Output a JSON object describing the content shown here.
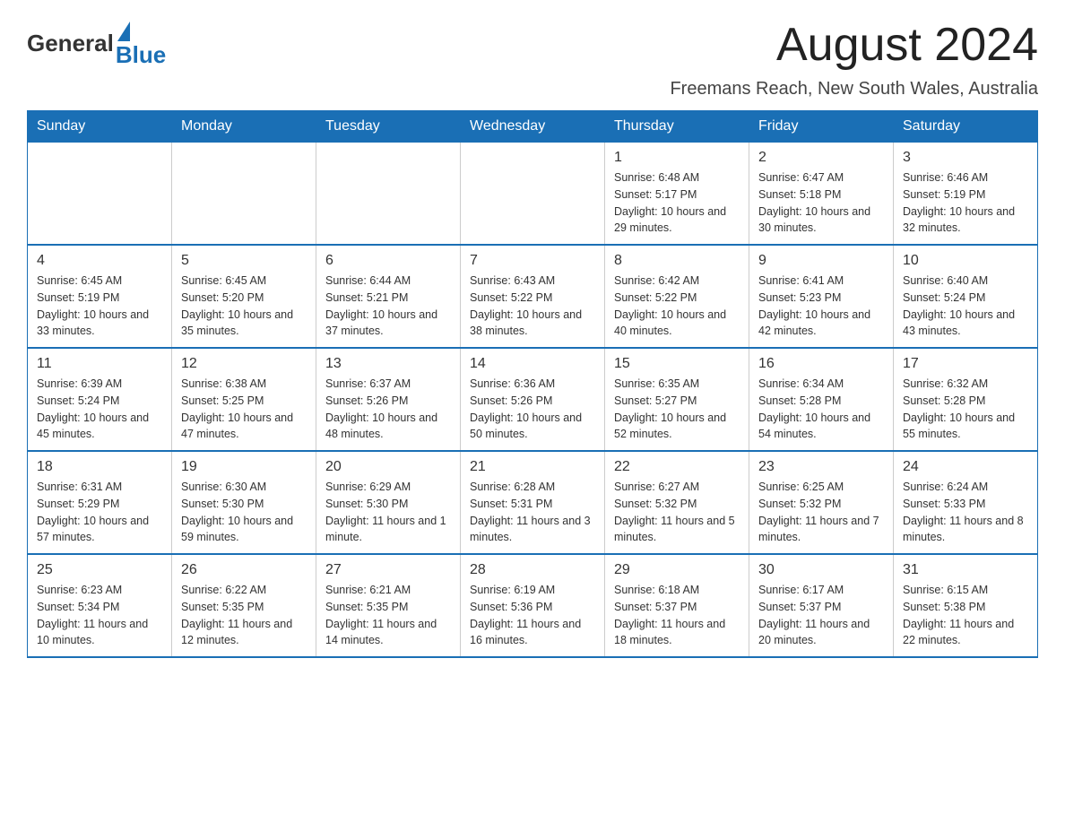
{
  "logo": {
    "general": "General",
    "blue": "Blue"
  },
  "title": "August 2024",
  "subtitle": "Freemans Reach, New South Wales, Australia",
  "days_of_week": [
    "Sunday",
    "Monday",
    "Tuesday",
    "Wednesday",
    "Thursday",
    "Friday",
    "Saturday"
  ],
  "weeks": [
    [
      {
        "day": "",
        "info": ""
      },
      {
        "day": "",
        "info": ""
      },
      {
        "day": "",
        "info": ""
      },
      {
        "day": "",
        "info": ""
      },
      {
        "day": "1",
        "info": "Sunrise: 6:48 AM\nSunset: 5:17 PM\nDaylight: 10 hours and 29 minutes."
      },
      {
        "day": "2",
        "info": "Sunrise: 6:47 AM\nSunset: 5:18 PM\nDaylight: 10 hours and 30 minutes."
      },
      {
        "day": "3",
        "info": "Sunrise: 6:46 AM\nSunset: 5:19 PM\nDaylight: 10 hours and 32 minutes."
      }
    ],
    [
      {
        "day": "4",
        "info": "Sunrise: 6:45 AM\nSunset: 5:19 PM\nDaylight: 10 hours and 33 minutes."
      },
      {
        "day": "5",
        "info": "Sunrise: 6:45 AM\nSunset: 5:20 PM\nDaylight: 10 hours and 35 minutes."
      },
      {
        "day": "6",
        "info": "Sunrise: 6:44 AM\nSunset: 5:21 PM\nDaylight: 10 hours and 37 minutes."
      },
      {
        "day": "7",
        "info": "Sunrise: 6:43 AM\nSunset: 5:22 PM\nDaylight: 10 hours and 38 minutes."
      },
      {
        "day": "8",
        "info": "Sunrise: 6:42 AM\nSunset: 5:22 PM\nDaylight: 10 hours and 40 minutes."
      },
      {
        "day": "9",
        "info": "Sunrise: 6:41 AM\nSunset: 5:23 PM\nDaylight: 10 hours and 42 minutes."
      },
      {
        "day": "10",
        "info": "Sunrise: 6:40 AM\nSunset: 5:24 PM\nDaylight: 10 hours and 43 minutes."
      }
    ],
    [
      {
        "day": "11",
        "info": "Sunrise: 6:39 AM\nSunset: 5:24 PM\nDaylight: 10 hours and 45 minutes."
      },
      {
        "day": "12",
        "info": "Sunrise: 6:38 AM\nSunset: 5:25 PM\nDaylight: 10 hours and 47 minutes."
      },
      {
        "day": "13",
        "info": "Sunrise: 6:37 AM\nSunset: 5:26 PM\nDaylight: 10 hours and 48 minutes."
      },
      {
        "day": "14",
        "info": "Sunrise: 6:36 AM\nSunset: 5:26 PM\nDaylight: 10 hours and 50 minutes."
      },
      {
        "day": "15",
        "info": "Sunrise: 6:35 AM\nSunset: 5:27 PM\nDaylight: 10 hours and 52 minutes."
      },
      {
        "day": "16",
        "info": "Sunrise: 6:34 AM\nSunset: 5:28 PM\nDaylight: 10 hours and 54 minutes."
      },
      {
        "day": "17",
        "info": "Sunrise: 6:32 AM\nSunset: 5:28 PM\nDaylight: 10 hours and 55 minutes."
      }
    ],
    [
      {
        "day": "18",
        "info": "Sunrise: 6:31 AM\nSunset: 5:29 PM\nDaylight: 10 hours and 57 minutes."
      },
      {
        "day": "19",
        "info": "Sunrise: 6:30 AM\nSunset: 5:30 PM\nDaylight: 10 hours and 59 minutes."
      },
      {
        "day": "20",
        "info": "Sunrise: 6:29 AM\nSunset: 5:30 PM\nDaylight: 11 hours and 1 minute."
      },
      {
        "day": "21",
        "info": "Sunrise: 6:28 AM\nSunset: 5:31 PM\nDaylight: 11 hours and 3 minutes."
      },
      {
        "day": "22",
        "info": "Sunrise: 6:27 AM\nSunset: 5:32 PM\nDaylight: 11 hours and 5 minutes."
      },
      {
        "day": "23",
        "info": "Sunrise: 6:25 AM\nSunset: 5:32 PM\nDaylight: 11 hours and 7 minutes."
      },
      {
        "day": "24",
        "info": "Sunrise: 6:24 AM\nSunset: 5:33 PM\nDaylight: 11 hours and 8 minutes."
      }
    ],
    [
      {
        "day": "25",
        "info": "Sunrise: 6:23 AM\nSunset: 5:34 PM\nDaylight: 11 hours and 10 minutes."
      },
      {
        "day": "26",
        "info": "Sunrise: 6:22 AM\nSunset: 5:35 PM\nDaylight: 11 hours and 12 minutes."
      },
      {
        "day": "27",
        "info": "Sunrise: 6:21 AM\nSunset: 5:35 PM\nDaylight: 11 hours and 14 minutes."
      },
      {
        "day": "28",
        "info": "Sunrise: 6:19 AM\nSunset: 5:36 PM\nDaylight: 11 hours and 16 minutes."
      },
      {
        "day": "29",
        "info": "Sunrise: 6:18 AM\nSunset: 5:37 PM\nDaylight: 11 hours and 18 minutes."
      },
      {
        "day": "30",
        "info": "Sunrise: 6:17 AM\nSunset: 5:37 PM\nDaylight: 11 hours and 20 minutes."
      },
      {
        "day": "31",
        "info": "Sunrise: 6:15 AM\nSunset: 5:38 PM\nDaylight: 11 hours and 22 minutes."
      }
    ]
  ]
}
